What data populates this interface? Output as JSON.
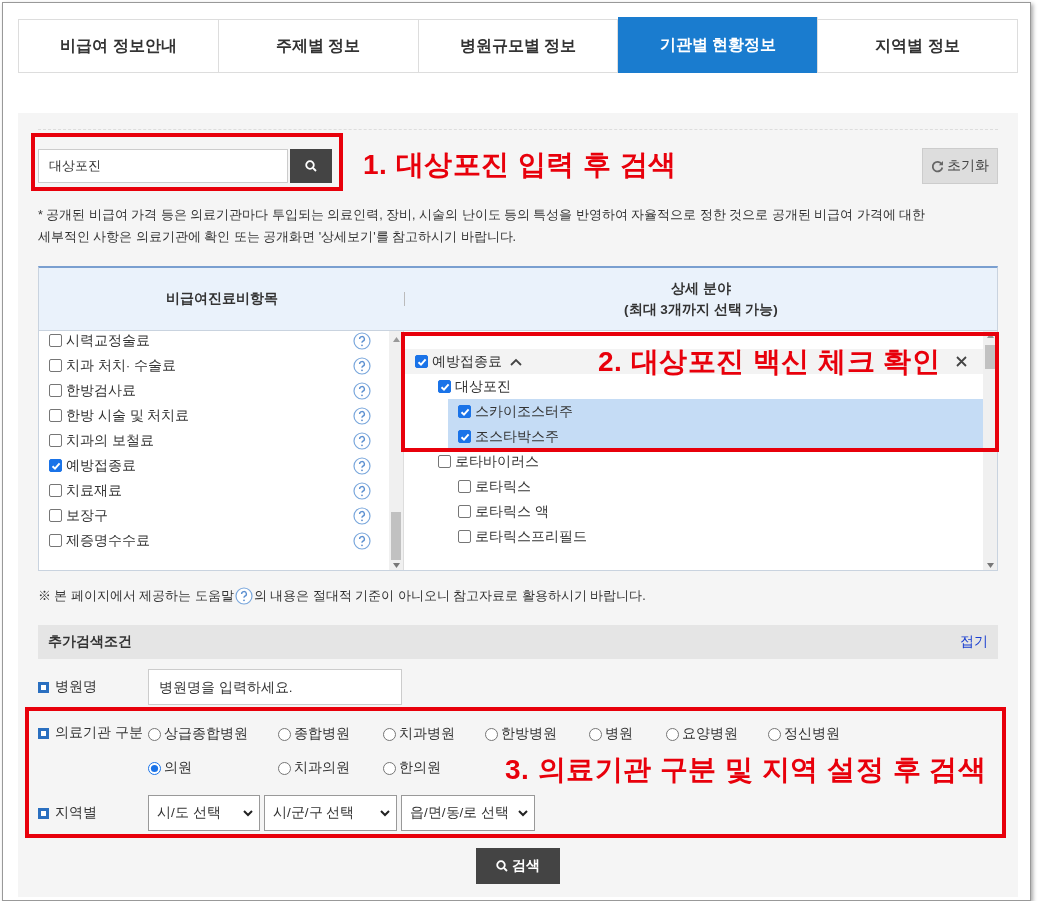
{
  "tabs": [
    {
      "label": "비급여 정보안내",
      "selected": false
    },
    {
      "label": "주제별 정보",
      "selected": false
    },
    {
      "label": "병원규모별 정보",
      "selected": false
    },
    {
      "label": "기관별 현황정보",
      "selected": true
    },
    {
      "label": "지역별 정보",
      "selected": false
    }
  ],
  "search": {
    "value": "대상포진"
  },
  "reset_button": "초기화",
  "notice": "* 공개된 비급여 가격 등은 의료기관마다 투입되는 의료인력, 장비, 시술의 난이도 등의 특성을 반영하여 자율적으로 정한 것으로 공개된 비급여 가격에 대한\n세부적인 사항은 의료기관에 확인 또는 공개화면 '상세보기'를 참고하시기 바랍니다.",
  "panel": {
    "left_heading": "비급여진료비항목",
    "right_heading": "상세 분야",
    "right_subheading": "(최대 3개까지 선택 가능)",
    "items": [
      {
        "label": "시력교정술료",
        "checked": false
      },
      {
        "label": "치과 처치· 수술료",
        "checked": false
      },
      {
        "label": "한방검사료",
        "checked": false
      },
      {
        "label": "한방 시술 및 처치료",
        "checked": false
      },
      {
        "label": "치과의 보철료",
        "checked": false
      },
      {
        "label": "예방접종료",
        "checked": true
      },
      {
        "label": "치료재료",
        "checked": false
      },
      {
        "label": "보장구",
        "checked": false
      },
      {
        "label": "제증명수수료",
        "checked": false
      }
    ],
    "tree": [
      {
        "label": "예방접종료",
        "checked": true,
        "expanded": true,
        "children": [
          {
            "label": "대상포진",
            "checked": true,
            "children": [
              {
                "label": "스카이조스터주",
                "checked": true,
                "selected": true
              },
              {
                "label": "조스타박스주",
                "checked": true,
                "selected": true
              }
            ]
          },
          {
            "label": "로타바이러스",
            "checked": false,
            "children": [
              {
                "label": "로타릭스",
                "checked": false,
                "selected": false
              },
              {
                "label": "로타릭스 액",
                "checked": false,
                "selected": false
              },
              {
                "label": "로타릭스프리필드",
                "checked": false,
                "selected": false
              }
            ]
          }
        ]
      }
    ]
  },
  "help_note": {
    "before": "※ 본 페이지에서 제공하는 도움말",
    "after": "의 내용은 절대적 기준이 아니오니 참고자료로 활용하시기 바랍니다."
  },
  "extra": {
    "title": "추가검색조건",
    "toggle": "접기",
    "hospital_name": {
      "label": "병원명",
      "placeholder": "병원명을 입력하세요."
    },
    "institution_type": {
      "label": "의료기관 구분",
      "options": [
        {
          "label": "상급종합병원",
          "selected": false
        },
        {
          "label": "종합병원",
          "selected": false
        },
        {
          "label": "치과병원",
          "selected": false
        },
        {
          "label": "한방병원",
          "selected": false
        },
        {
          "label": "병원",
          "selected": false
        },
        {
          "label": "요양병원",
          "selected": false
        },
        {
          "label": "정신병원",
          "selected": false
        },
        {
          "label": "의원",
          "selected": true
        },
        {
          "label": "치과의원",
          "selected": false
        },
        {
          "label": "한의원",
          "selected": false
        }
      ]
    },
    "region": {
      "label": "지역별",
      "selects": [
        "시/도 선택",
        "시/군/구 선택",
        "읍/면/동/로 선택"
      ]
    }
  },
  "search_button": "검색",
  "annotations": [
    {
      "text": "1. 대상포진 입력 후 검색"
    },
    {
      "text": "2. 대상포진 백신 체크 확인"
    },
    {
      "text": "3. 의료기관 구분 및 지역 설정 후 검색"
    }
  ]
}
